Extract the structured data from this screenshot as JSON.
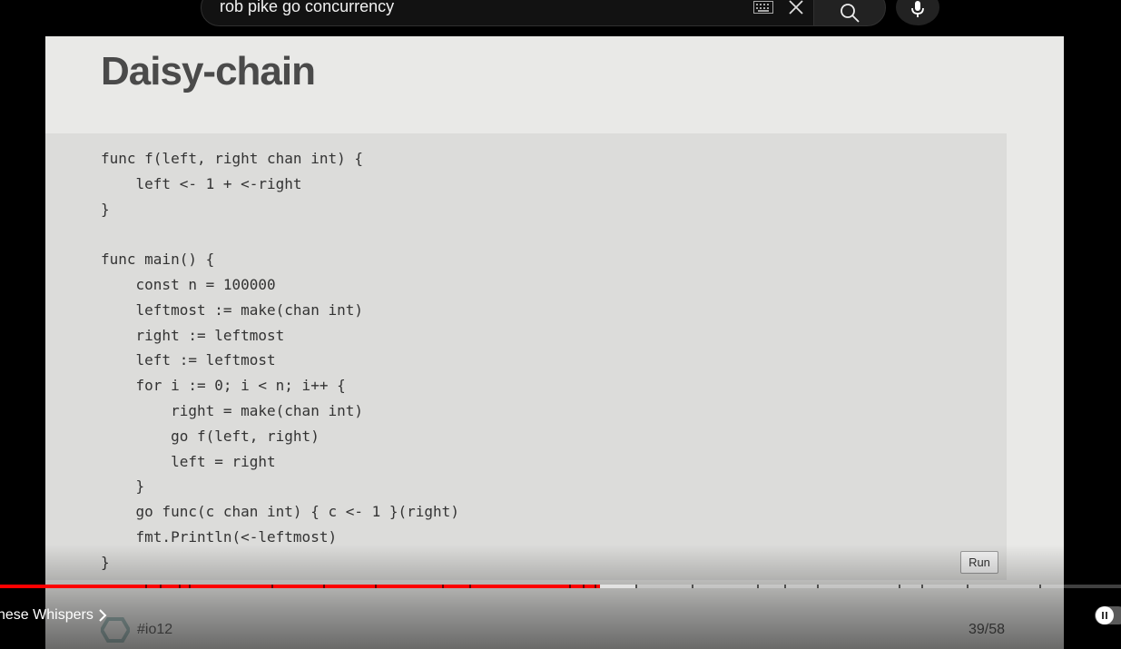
{
  "search": {
    "query": "rob pike go concurrency"
  },
  "slide": {
    "title": "Daisy-chain",
    "code": "func f(left, right chan int) {\n    left <- 1 + <-right\n}\n\nfunc main() {\n    const n = 100000\n    leftmost := make(chan int)\n    right := leftmost\n    left := leftmost\n    for i := 0; i < n; i++ {\n        right = make(chan int)\n        go f(left, right)\n        left = right\n    }\n    go func(c chan int) { c <- 1 }(right)\n    fmt.Println(<-leftmost)\n}",
    "run_label": "Run",
    "tag": "#io12",
    "page": "39/58"
  },
  "player": {
    "progress_played": 0.535,
    "progress_buffered": 0.567,
    "chapter_title": "nese Whispers",
    "played_color": "#ff0000"
  },
  "icons": [
    "keyboard-icon",
    "clear-icon",
    "search-icon",
    "mic-icon",
    "chevron-right-icon",
    "pause-icon",
    "io-logo-icon"
  ]
}
